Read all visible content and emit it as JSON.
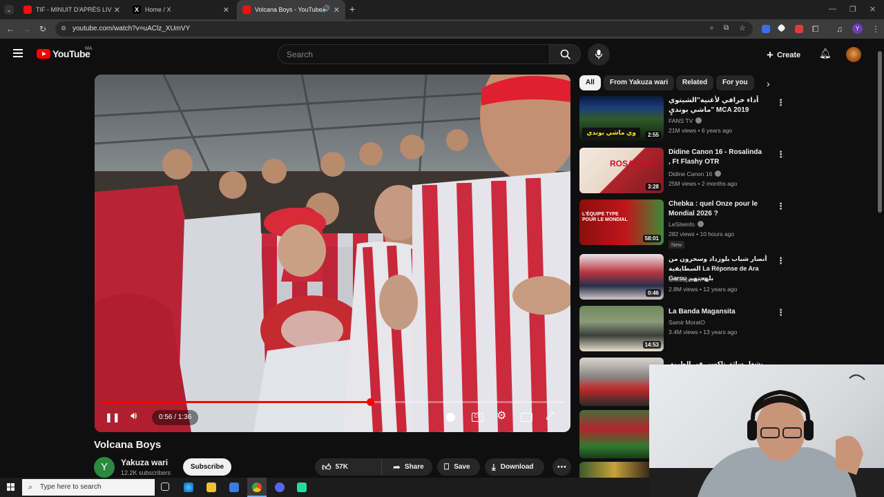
{
  "browser": {
    "tabs": [
      {
        "title": "TIF - MINUIT D'APRÈS LIVE SES",
        "active": false,
        "favicon": "youtube-icon"
      },
      {
        "title": "Home / X",
        "active": false,
        "favicon": "x-icon"
      },
      {
        "title": "Volcana Boys - YouTube",
        "active": true,
        "favicon": "youtube-icon"
      }
    ],
    "url": "youtube.com/watch?v=uAClz_XUmVY"
  },
  "youtube": {
    "logo_text": "YouTube",
    "country_code": "MA",
    "search_placeholder": "Search",
    "create_label": "Create"
  },
  "player": {
    "current_time": "0:56",
    "duration": "1:36",
    "time_display": "0:56 / 1:36",
    "progress_fraction": 0.58
  },
  "video": {
    "title": "Volcana Boys",
    "channel": "Yakuza wari",
    "channel_initial": "Y",
    "subscribers": "12.2K subscribers",
    "subscribe_label": "Subscribe",
    "likes": "57K",
    "share_label": "Share",
    "save_label": "Save",
    "download_label": "Download"
  },
  "chips": [
    "All",
    "From Yakuza wari",
    "Related",
    "For you"
  ],
  "recommendations": [
    {
      "title": "أداء خرافي لأغنية\"الشيتوي ماشي بونديٍ\" MCA 2019",
      "channel": "FANS TV",
      "verified": true,
      "meta": "21M views • 6 years ago",
      "duration": "2:55",
      "new": ""
    },
    {
      "title": "Didine Canon 16 - Rosalinda , Ft Flashy OTR",
      "channel": "Didine Canon 16",
      "verified": true,
      "meta": "25M views • 2 months ago",
      "duration": "3:28",
      "new": ""
    },
    {
      "title": "Chebka : quel Onze pour le Mondial 2026 ?",
      "channel": "LeSiteinfo",
      "verified": true,
      "meta": "282 views • 10 hours ago",
      "duration": "58:01",
      "new": "New"
    },
    {
      "title": "أنصار شباب بلوزداد وسخرون من السطايفية La Réponse de Ara Garou بلهجتهم",
      "channel": "Chkoupistan TV",
      "verified": false,
      "meta": "2.8M views • 12 years ago",
      "duration": "0:46",
      "new": ""
    },
    {
      "title": "La Banda Magansita",
      "channel": "Samir MoratO",
      "verified": false,
      "meta": "3.4M views • 13 years ago",
      "duration": "14:53",
      "new": ""
    },
    {
      "title": "أيمن السرحاني يشغل سائق تاكسي في الطريق",
      "channel": "",
      "verified": false,
      "meta": "",
      "duration": "",
      "new": ""
    }
  ],
  "taskbar": {
    "search_placeholder": "Type here to search"
  },
  "colors": {
    "accent_red": "#ff0000",
    "background": "#0f0f0f"
  }
}
